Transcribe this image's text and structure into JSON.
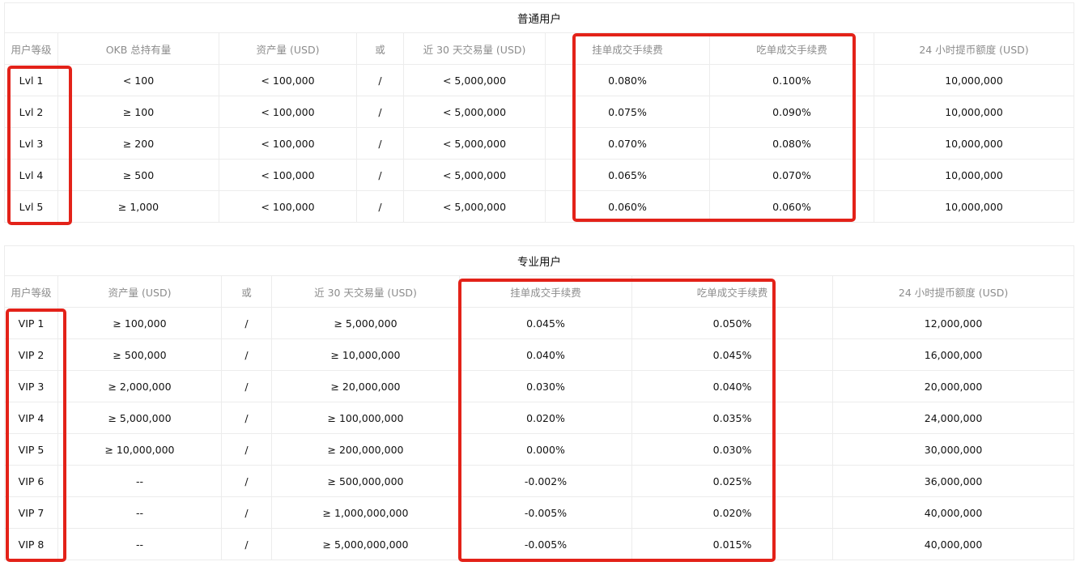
{
  "standard": {
    "title": "普通用户",
    "headers": [
      "用户等级",
      "OKB 总持有量",
      "资产量 (USD)",
      "或",
      "近 30 天交易量 (USD)",
      "挂单成交手续费",
      "吃单成交手续费",
      "24 小时提币额度 (USD)"
    ],
    "rows": [
      [
        "Lvl 1",
        "< 100",
        "< 100,000",
        "/",
        "< 5,000,000",
        "0.080%",
        "0.100%",
        "10,000,000"
      ],
      [
        "Lvl 2",
        "≥ 100",
        "< 100,000",
        "/",
        "< 5,000,000",
        "0.075%",
        "0.090%",
        "10,000,000"
      ],
      [
        "Lvl 3",
        "≥ 200",
        "< 100,000",
        "/",
        "< 5,000,000",
        "0.070%",
        "0.080%",
        "10,000,000"
      ],
      [
        "Lvl 4",
        "≥ 500",
        "< 100,000",
        "/",
        "< 5,000,000",
        "0.065%",
        "0.070%",
        "10,000,000"
      ],
      [
        "Lvl 5",
        "≥ 1,000",
        "< 100,000",
        "/",
        "< 5,000,000",
        "0.060%",
        "0.060%",
        "10,000,000"
      ]
    ]
  },
  "professional": {
    "title": "专业用户",
    "headers": [
      "用户等级",
      "资产量 (USD)",
      "或",
      "近 30 天交易量 (USD)",
      "挂单成交手续费",
      "吃单成交手续费",
      "24 小时提币额度 (USD)"
    ],
    "rows": [
      [
        "VIP 1",
        "≥ 100,000",
        "/",
        "≥ 5,000,000",
        "0.045%",
        "0.050%",
        "12,000,000"
      ],
      [
        "VIP 2",
        "≥ 500,000",
        "/",
        "≥ 10,000,000",
        "0.040%",
        "0.045%",
        "16,000,000"
      ],
      [
        "VIP 3",
        "≥ 2,000,000",
        "/",
        "≥ 20,000,000",
        "0.030%",
        "0.040%",
        "20,000,000"
      ],
      [
        "VIP 4",
        "≥ 5,000,000",
        "/",
        "≥ 100,000,000",
        "0.020%",
        "0.035%",
        "24,000,000"
      ],
      [
        "VIP 5",
        "≥ 10,000,000",
        "/",
        "≥ 200,000,000",
        "0.000%",
        "0.030%",
        "30,000,000"
      ],
      [
        "VIP 6",
        "--",
        "/",
        "≥ 500,000,000",
        "-0.002%",
        "0.025%",
        "36,000,000"
      ],
      [
        "VIP 7",
        "--",
        "/",
        "≥ 1,000,000,000",
        "-0.005%",
        "0.020%",
        "40,000,000"
      ],
      [
        "VIP 8",
        "--",
        "/",
        "≥ 5,000,000,000",
        "-0.005%",
        "0.015%",
        "40,000,000"
      ]
    ]
  },
  "colors": {
    "highlight": "#e32219",
    "border": "#ececec",
    "header_text": "#8c8c8c",
    "text": "#121212"
  }
}
